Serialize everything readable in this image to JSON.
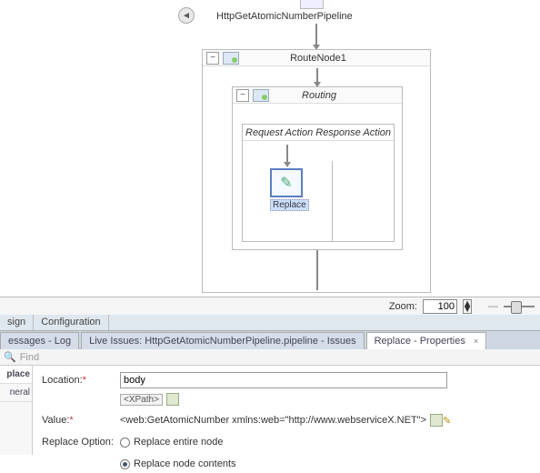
{
  "pipeline": {
    "title": "HttpGetAtomicNumberPipeline"
  },
  "route": {
    "title": "RouteNode1",
    "routing_title": "Routing",
    "req_resp": "Request Action Response Action",
    "replace_label": "Replace"
  },
  "zoom": {
    "label": "Zoom:",
    "value": "100"
  },
  "design_tabs": {
    "design": "sign",
    "config": "Configuration"
  },
  "bottom_tabs": {
    "messages": "essages - Log",
    "issues": "Live Issues: HttpGetAtomicNumberPipeline.pipeline - Issues",
    "props": "Replace - Properties"
  },
  "find": {
    "placeholder": "Find"
  },
  "side": {
    "replace": "place",
    "general": "neral"
  },
  "form": {
    "location_label": "Location:",
    "location_value": "body",
    "xpath_chip": "<XPath>",
    "value_label": "Value:",
    "value_text": "<web:GetAtomicNumber xmlns:web=\"http://www.webserviceX.NET\">",
    "option_label": "Replace Option:",
    "opt_entire": "Replace entire node",
    "opt_contents": "Replace node contents"
  }
}
